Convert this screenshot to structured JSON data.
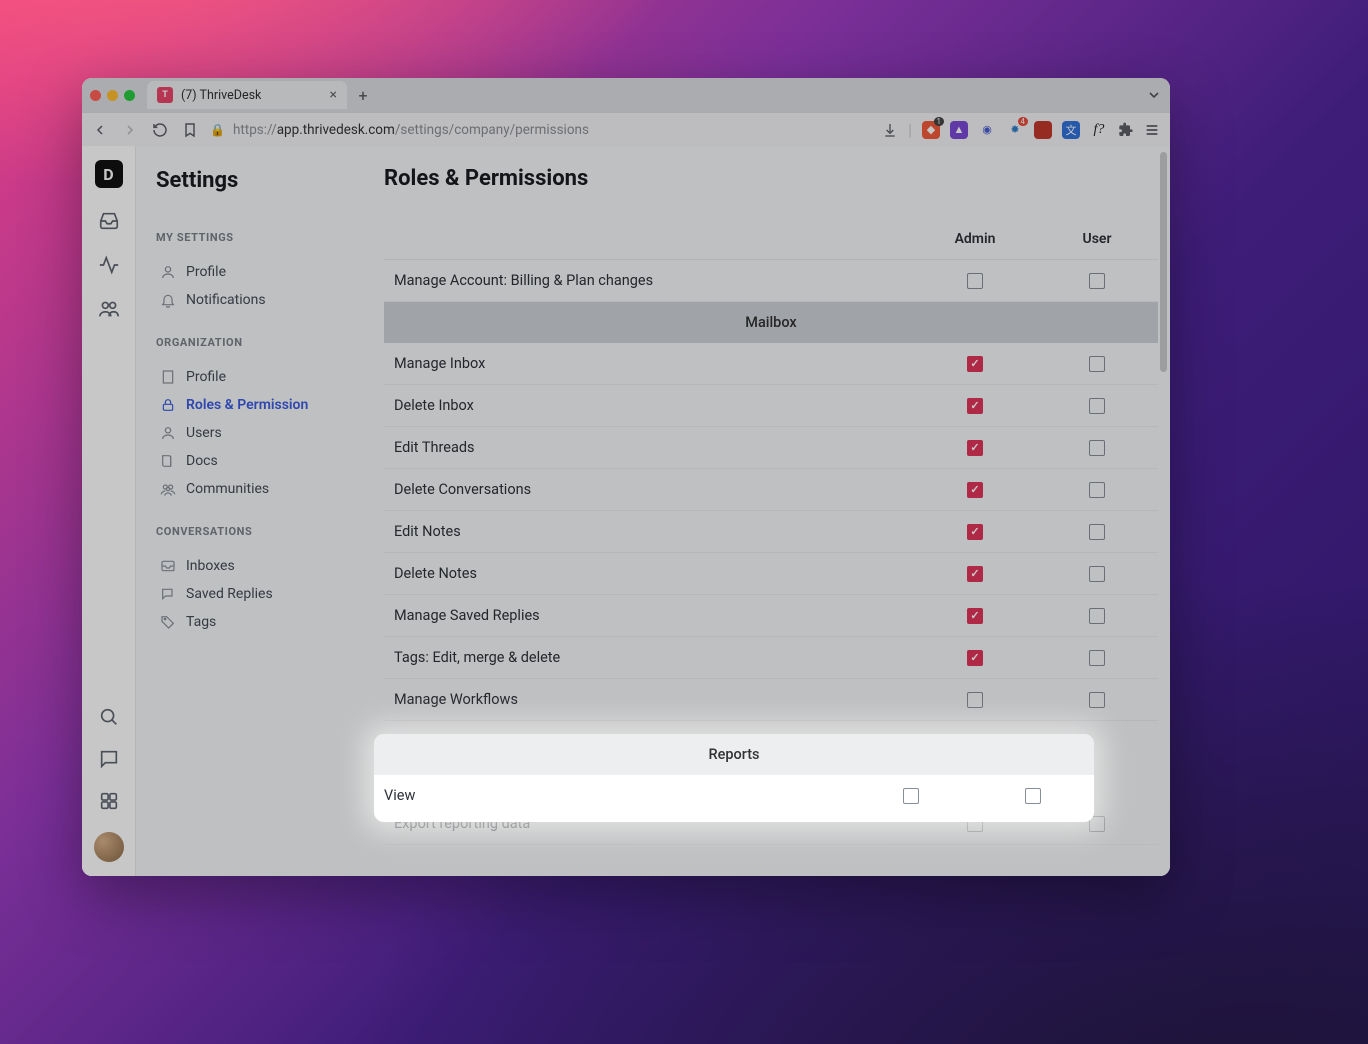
{
  "browser": {
    "tab_title": "(7) ThriveDesk",
    "url_proto": "https://",
    "url_host": "app.thrivedesk.com",
    "url_path": "/settings/company/permissions",
    "ext_shield_badge": "1",
    "ext_red_badge": "4"
  },
  "rail": {
    "logo": "D"
  },
  "sidebar": {
    "title": "Settings",
    "sec_my": "MY SETTINGS",
    "my_items": [
      {
        "icon": "user",
        "label": "Profile"
      },
      {
        "icon": "bell",
        "label": "Notifications"
      }
    ],
    "sec_org": "ORGANIZATION",
    "org_items": [
      {
        "icon": "building",
        "label": "Profile",
        "active": false
      },
      {
        "icon": "lock",
        "label": "Roles & Permission",
        "active": true
      },
      {
        "icon": "user",
        "label": "Users",
        "active": false
      },
      {
        "icon": "book",
        "label": "Docs",
        "active": false
      },
      {
        "icon": "users",
        "label": "Communities",
        "active": false
      }
    ],
    "sec_conv": "CONVERSATIONS",
    "conv_items": [
      {
        "icon": "inbox",
        "label": "Inboxes"
      },
      {
        "icon": "reply",
        "label": "Saved Replies"
      },
      {
        "icon": "tag",
        "label": "Tags"
      }
    ]
  },
  "main": {
    "title": "Roles & Permissions",
    "roles": [
      "Admin",
      "User"
    ],
    "rows": [
      {
        "type": "perm",
        "label": "Manage Account: Billing & Plan changes",
        "admin": false,
        "user": false
      },
      {
        "type": "group",
        "label": "Mailbox"
      },
      {
        "type": "perm",
        "label": "Manage Inbox",
        "admin": true,
        "user": false
      },
      {
        "type": "perm",
        "label": "Delete Inbox",
        "admin": true,
        "user": false
      },
      {
        "type": "perm",
        "label": "Edit Threads",
        "admin": true,
        "user": false
      },
      {
        "type": "perm",
        "label": "Delete Conversations",
        "admin": true,
        "user": false
      },
      {
        "type": "perm",
        "label": "Edit Notes",
        "admin": true,
        "user": false
      },
      {
        "type": "perm",
        "label": "Delete Notes",
        "admin": true,
        "user": false
      },
      {
        "type": "perm",
        "label": "Manage Saved Replies",
        "admin": true,
        "user": false
      },
      {
        "type": "perm",
        "label": "Tags: Edit, merge & delete",
        "admin": true,
        "user": false
      },
      {
        "type": "perm",
        "label": "Manage Workflows",
        "admin": false,
        "user": false
      }
    ],
    "highlight": {
      "group": "Reports",
      "row_label": "View",
      "admin": false,
      "user": false
    },
    "after": {
      "label": "Export reporting data",
      "admin": false,
      "user": false
    }
  }
}
